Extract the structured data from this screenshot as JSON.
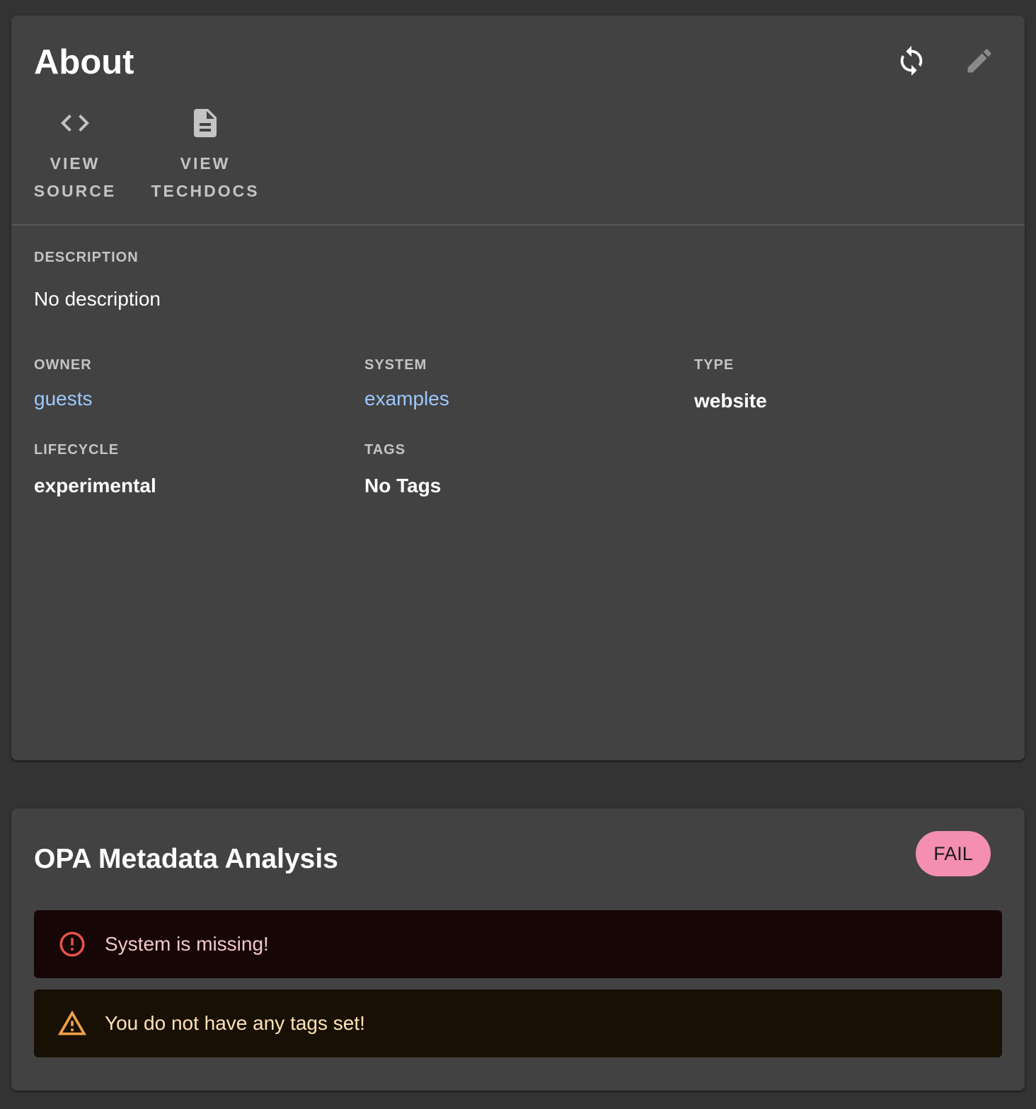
{
  "about": {
    "title": "About",
    "refresh_icon": "refresh-icon",
    "edit_icon": "edit-icon",
    "links": [
      {
        "label_line1": "VIEW",
        "label_line2": "SOURCE",
        "icon": "code-icon"
      },
      {
        "label_line1": "VIEW",
        "label_line2": "TECHDOCS",
        "icon": "document-icon"
      }
    ],
    "description": {
      "label": "DESCRIPTION",
      "value": "No description"
    },
    "owner": {
      "label": "OWNER",
      "value": "guests"
    },
    "system": {
      "label": "SYSTEM",
      "value": "examples"
    },
    "type": {
      "label": "TYPE",
      "value": "website"
    },
    "lifecycle": {
      "label": "LIFECYCLE",
      "value": "experimental"
    },
    "tags": {
      "label": "TAGS",
      "value": "No Tags"
    }
  },
  "opa": {
    "title": "OPA Metadata Analysis",
    "status": "FAIL",
    "alerts": [
      {
        "severity": "error",
        "icon": "error-icon",
        "message": "System is missing!"
      },
      {
        "severity": "warning",
        "icon": "warning-icon",
        "message": "You do not have any tags set!"
      }
    ]
  },
  "colors": {
    "background": "#333333",
    "card": "#424242",
    "link": "#9cc9ff",
    "fail_chip": "#f48fb1",
    "error_bg": "#160605",
    "error_icon": "#e5534b",
    "warning_bg": "#181004",
    "warning_icon": "#f0a04b"
  }
}
